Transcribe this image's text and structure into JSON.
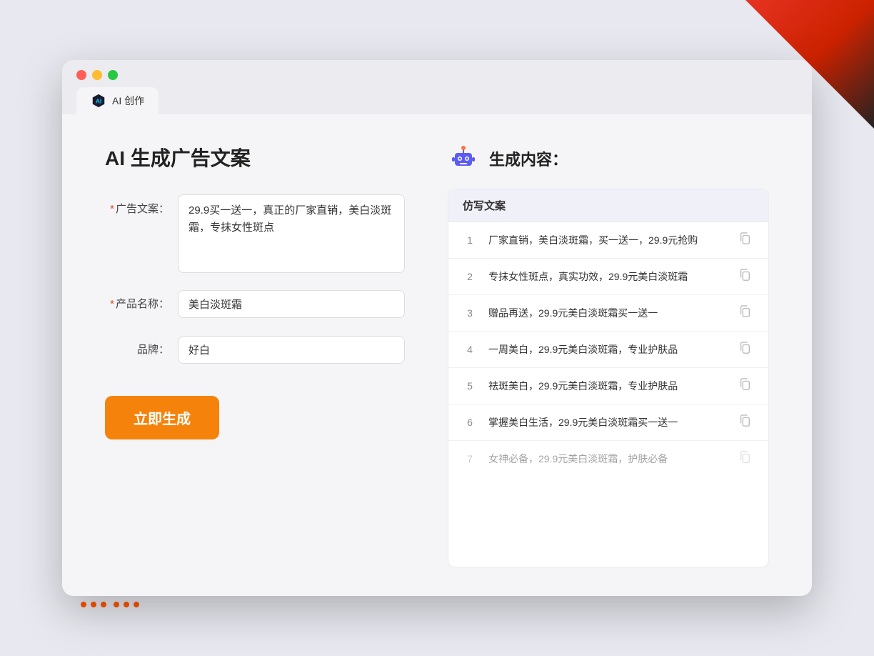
{
  "window": {
    "traffic_lights": [
      "red",
      "yellow",
      "green"
    ],
    "tab_label": "AI 创作"
  },
  "page": {
    "title": "AI 生成广告文案",
    "result_header": "生成内容："
  },
  "form": {
    "ad_copy_label": "广告文案：",
    "ad_copy_value": "29.9买一送一，真正的厂家直销，美白淡斑霜，专抹女性斑点",
    "product_name_label": "产品名称：",
    "product_name_value": "美白淡斑霜",
    "brand_label": "品牌：",
    "brand_value": "好白",
    "generate_btn": "立即生成"
  },
  "results": {
    "table_header": "仿写文案",
    "rows": [
      {
        "num": "1",
        "text": "厂家直销，美白淡斑霜，买一送一，29.9元抢购",
        "faded": false
      },
      {
        "num": "2",
        "text": "专抹女性斑点，真实功效，29.9元美白淡斑霜",
        "faded": false
      },
      {
        "num": "3",
        "text": "赠品再送，29.9元美白淡斑霜买一送一",
        "faded": false
      },
      {
        "num": "4",
        "text": "一周美白，29.9元美白淡斑霜，专业护肤品",
        "faded": false
      },
      {
        "num": "5",
        "text": "祛斑美白，29.9元美白淡斑霜，专业护肤品",
        "faded": false
      },
      {
        "num": "6",
        "text": "掌握美白生活，29.9元美白淡斑霜买一送一",
        "faded": false
      },
      {
        "num": "7",
        "text": "女神必备，29.9元美白淡斑霜，护肤必备",
        "faded": true
      }
    ]
  }
}
